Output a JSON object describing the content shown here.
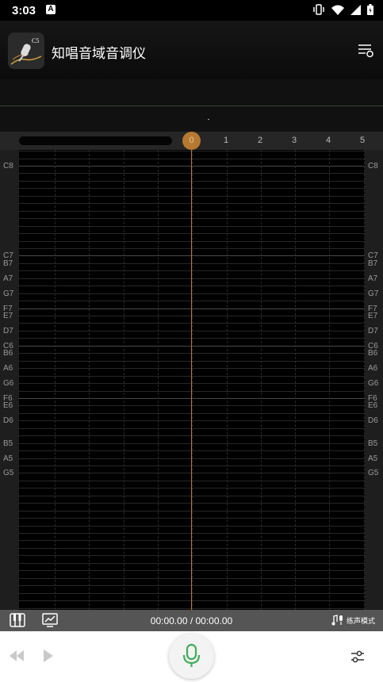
{
  "status_bar": {
    "time": "3:03",
    "notification_letter": "A",
    "icons": [
      "vibrate-icon",
      "wifi-icon",
      "signal-icon",
      "battery-icon"
    ]
  },
  "app_bar": {
    "title": "知唱音域音调仪",
    "logo_icon": "app-logo-mic-icon",
    "logo_text": "C5",
    "menu_icon": "playlist-settings-icon"
  },
  "timeline": {
    "playhead_label": "0",
    "ticks": [
      "1",
      "2",
      "3",
      "4",
      "5"
    ]
  },
  "pitch_grid": {
    "notes": [
      "C8",
      "B7",
      "A7",
      "G7",
      "F7",
      "E7",
      "D7",
      "C7",
      "B6",
      "A6",
      "G6",
      "F6",
      "E6",
      "D6",
      "C6",
      "B5",
      "A5",
      "G5"
    ]
  },
  "control_bar": {
    "time_display": "00:00.00 / 00:00.00",
    "practice_mode_label": "练声模式",
    "left_icons": [
      "piano-icon",
      "chart-icon"
    ]
  },
  "bottom_bar": {
    "icons": [
      "rewind-icon",
      "play-icon",
      "microphone-icon",
      "sliders-icon"
    ]
  },
  "colors": {
    "accent": "#b57931",
    "mic_green": "#3fae58",
    "grid_bg": "#000000"
  }
}
